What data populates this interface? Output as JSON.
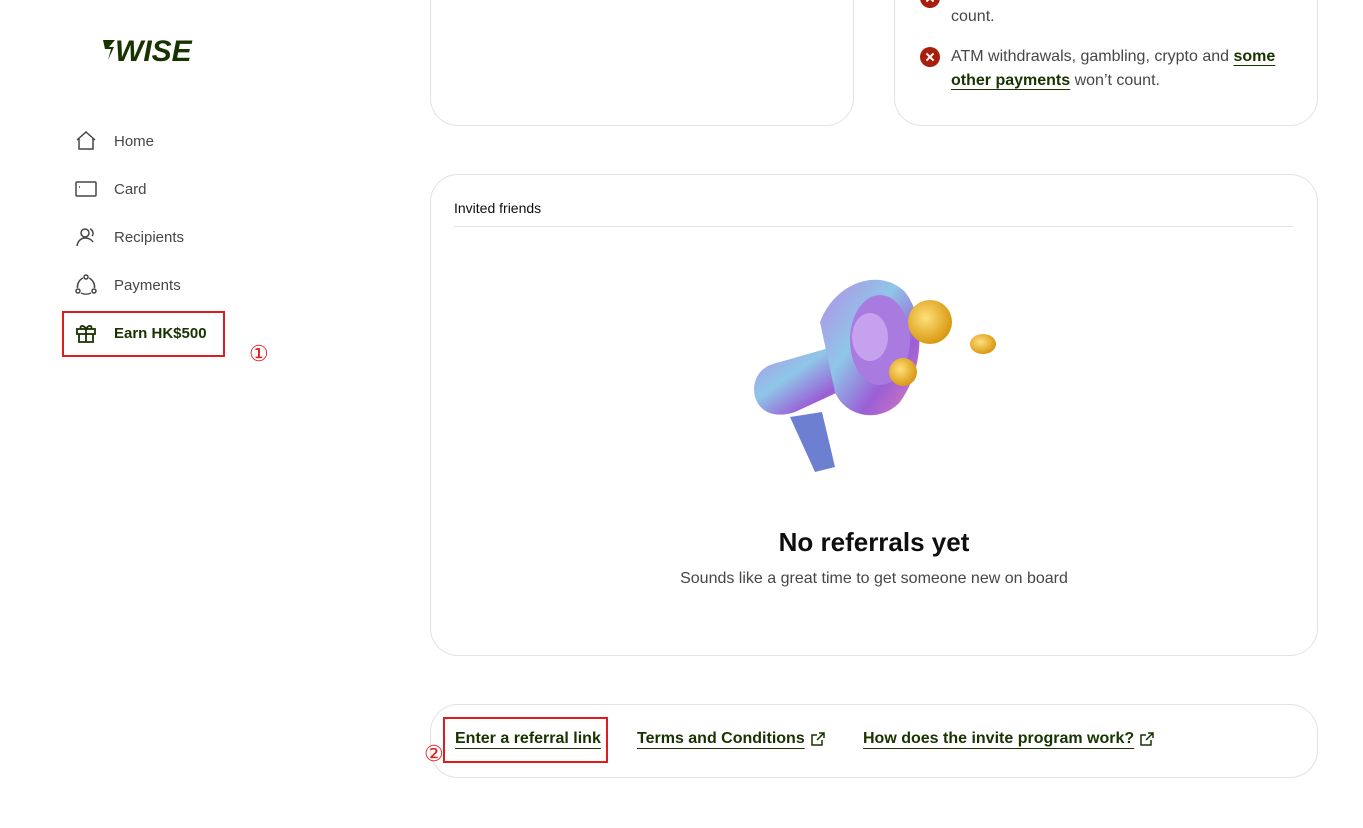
{
  "brand": {
    "logo_text": "WISE",
    "accent": "#163300",
    "brand_green": "#9fe870"
  },
  "sidebar": {
    "items": [
      {
        "label": "Home",
        "icon": "home-icon"
      },
      {
        "label": "Card",
        "icon": "card-icon"
      },
      {
        "label": "Recipients",
        "icon": "recipients-icon"
      },
      {
        "label": "Payments",
        "icon": "payments-icon"
      },
      {
        "label": "Earn HK$500",
        "icon": "gift-icon",
        "active": true
      }
    ]
  },
  "annotations": {
    "one": "①",
    "two": "②",
    "color": "#e21c1c"
  },
  "rules": {
    "partial_line": "count.",
    "atm_text": "ATM withdrawals, gambling, crypto and ",
    "atm_link": "some other payments",
    "atm_suffix": " won’t count."
  },
  "invited": {
    "title": "Invited friends",
    "empty_title": "No referrals yet",
    "empty_subtitle": "Sounds like a great time to get someone new on board"
  },
  "footer_links": {
    "referral": "Enter a referral link",
    "terms": "Terms and Conditions",
    "how": "How does the invite program work?"
  }
}
